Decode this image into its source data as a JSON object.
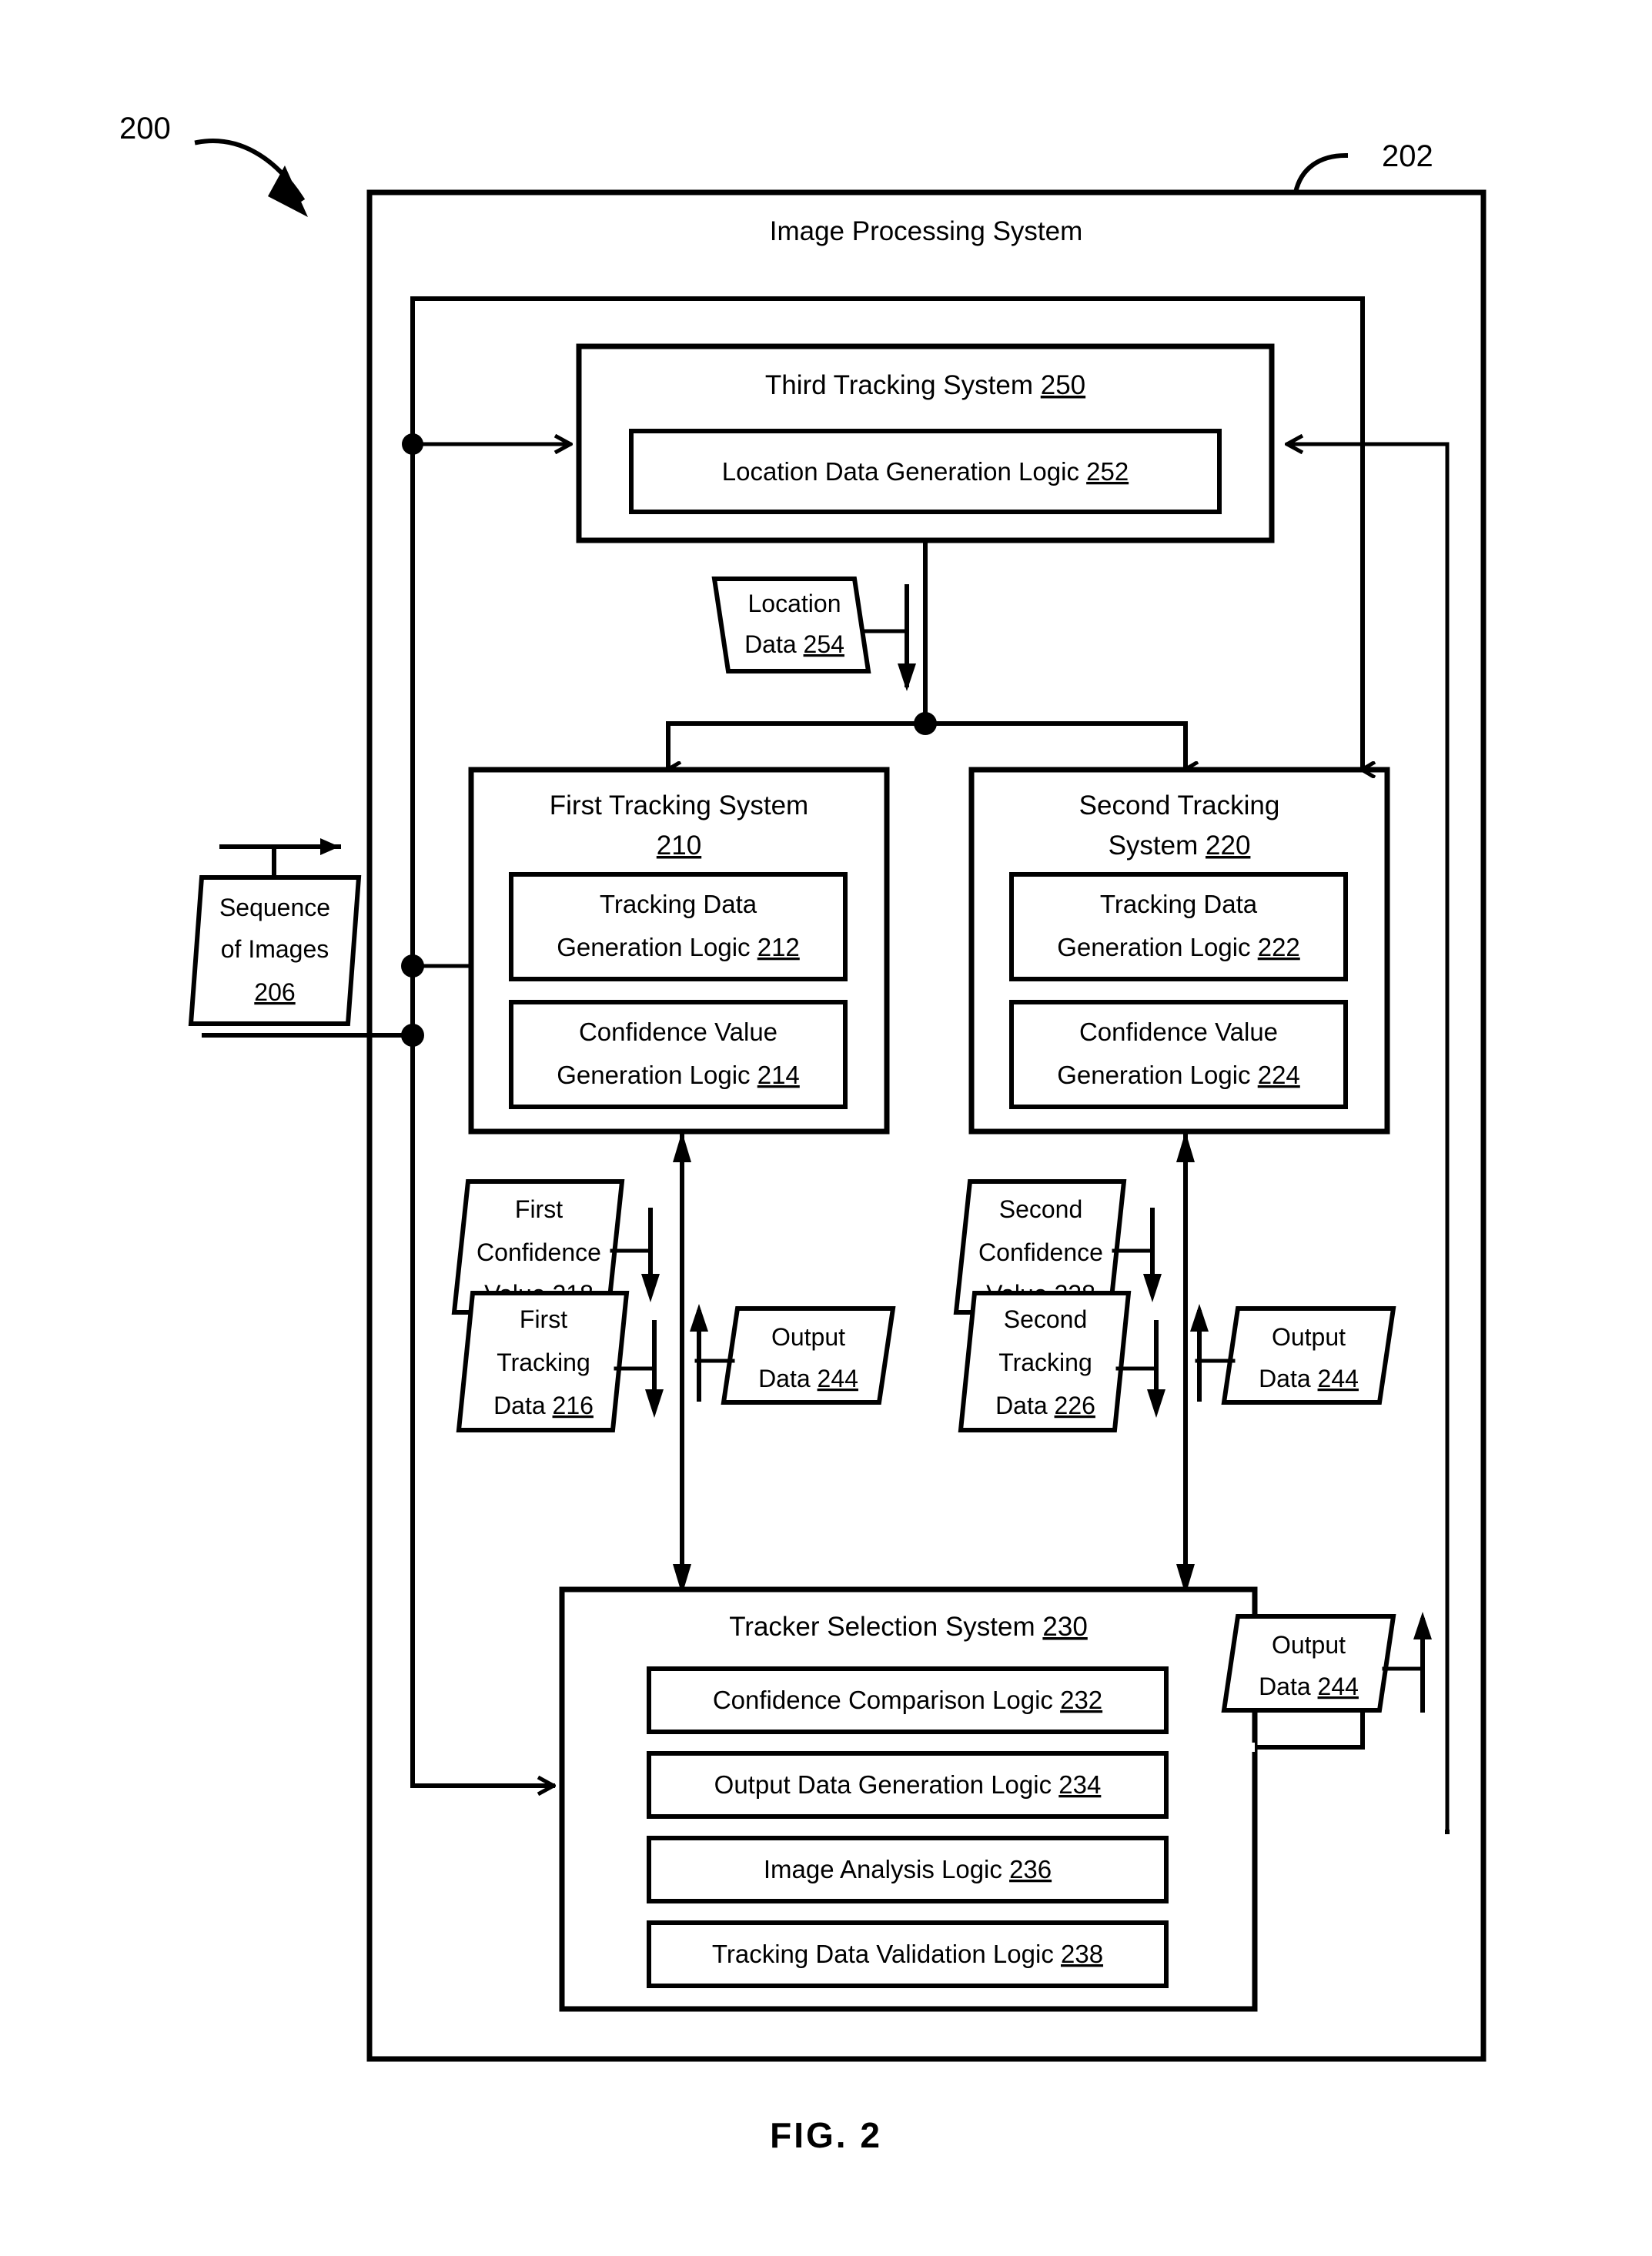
{
  "figure": {
    "caption": "FIG.  2",
    "system_ref": "200",
    "outer_ref": "202"
  },
  "outer_box": {
    "title": "Image Processing System"
  },
  "third_tracking_system": {
    "title": "Third Tracking System",
    "ref": "250",
    "children": [
      {
        "label": "Location Data Generation Logic",
        "ref": "252"
      }
    ]
  },
  "location_data": {
    "line1": "Location",
    "line2": "Data",
    "ref": "254"
  },
  "sequence_of_images": {
    "line1": "Sequence",
    "line2": "of Images",
    "ref": "206"
  },
  "first_tracking_system": {
    "title_line1": "First Tracking System",
    "ref": "210",
    "children": [
      {
        "line1": "Tracking Data",
        "line2": "Generation Logic",
        "ref": "212"
      },
      {
        "line1": "Confidence Value",
        "line2": "Generation Logic",
        "ref": "214"
      }
    ]
  },
  "second_tracking_system": {
    "title_line1": "Second Tracking",
    "title_line2": "System",
    "ref": "220",
    "children": [
      {
        "line1": "Tracking Data",
        "line2": "Generation Logic",
        "ref": "222"
      },
      {
        "line1": "Confidence Value",
        "line2": "Generation Logic",
        "ref": "224"
      }
    ]
  },
  "first_confidence_value": {
    "line1": "First",
    "line2": "Confidence",
    "line3": "Value",
    "ref": "218"
  },
  "first_tracking_data": {
    "line1": "First",
    "line2": "Tracking",
    "line3": "Data",
    "ref": "216"
  },
  "second_confidence_value": {
    "line1": "Second",
    "line2": "Confidence",
    "line3": "Value",
    "ref": "228"
  },
  "second_tracking_data": {
    "line1": "Second",
    "line2": "Tracking",
    "line3": "Data",
    "ref": "226"
  },
  "output_data_left": {
    "line1": "Output",
    "line2": "Data",
    "ref": "244"
  },
  "output_data_right": {
    "line1": "Output",
    "line2": "Data",
    "ref": "244"
  },
  "output_data_bottom": {
    "line1": "Output",
    "line2": "Data",
    "ref": "244"
  },
  "tracker_selection_system": {
    "title": "Tracker Selection System",
    "ref": "230",
    "children": [
      {
        "label": "Confidence Comparison Logic",
        "ref": "232"
      },
      {
        "label": "Output Data Generation Logic",
        "ref": "234"
      },
      {
        "label": "Image Analysis Logic",
        "ref": "236"
      },
      {
        "label": "Tracking Data Validation Logic",
        "ref": "238"
      }
    ]
  },
  "colors": {
    "stroke": "#000000",
    "background": "#ffffff"
  }
}
